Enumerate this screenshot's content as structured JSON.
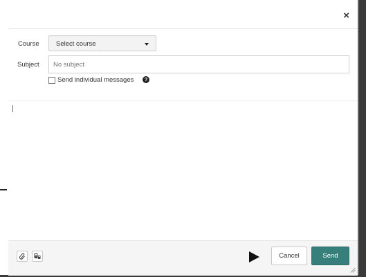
{
  "dialog": {
    "close_glyph": "×"
  },
  "form": {
    "course_label": "Course",
    "course_selected": "Select course",
    "subject_label": "Subject",
    "subject_value": "",
    "subject_placeholder": "No subject",
    "individual_label": "Send individual messages",
    "individual_checked": false,
    "help_glyph": "?"
  },
  "footer": {
    "attach_icon": "paperclip-icon",
    "media_icon": "media-comment-icon",
    "cancel_label": "Cancel",
    "send_label": "Send"
  },
  "colors": {
    "send_bg": "#367f7b",
    "frame": "#3a3a3a"
  }
}
